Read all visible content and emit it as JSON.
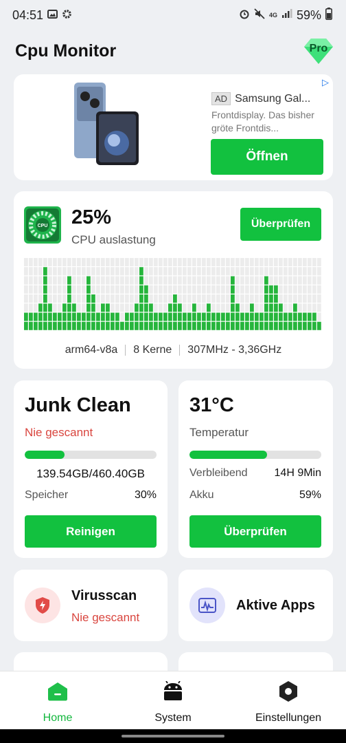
{
  "status_bar": {
    "time": "04:51",
    "left_icons": [
      "image-icon",
      "gear-icon"
    ],
    "right_icons": [
      "alarm-icon",
      "mute-icon",
      "4g-icon",
      "signal-icon"
    ],
    "battery": "59%"
  },
  "app": {
    "title": "Cpu Monitor",
    "pro_badge": "Pro"
  },
  "ad": {
    "tag": "AD",
    "title": "Samsung Gal...",
    "description": "Frontdisplay. Das bisher gröte Frontdis...",
    "button": "Öffnen"
  },
  "cpu": {
    "percent": "25%",
    "label": "CPU auslastung",
    "button": "Überprüfen",
    "arch": "arm64-v8a",
    "cores": "8 Kerne",
    "freq": "307MHz - 3,36GHz",
    "usage_history": [
      2,
      2,
      2,
      3,
      7,
      3,
      2,
      2,
      3,
      6,
      3,
      2,
      2,
      6,
      4,
      2,
      3,
      3,
      2,
      2,
      1,
      2,
      2,
      3,
      7,
      5,
      3,
      2,
      2,
      2,
      3,
      4,
      3,
      2,
      2,
      3,
      2,
      2,
      3,
      2,
      2,
      2,
      2,
      6,
      3,
      2,
      2,
      3,
      2,
      2,
      6,
      5,
      5,
      3,
      2,
      2,
      3,
      2,
      2,
      2,
      2,
      1
    ],
    "grid_rows": 8,
    "grid_accent": "#26b53c",
    "grid_empty": "#ececec"
  },
  "junk": {
    "title": "Junk Clean",
    "status": "Nie gescannt",
    "progress": 0.3,
    "storage_value": "139.54GB/460.40GB",
    "storage_label": "Speicher",
    "storage_percent": "30%",
    "button": "Reinigen"
  },
  "battery": {
    "temperature": "31°C",
    "temperature_label": "Temperatur",
    "progress": 0.59,
    "remaining_label": "Verbleibend",
    "remaining_value": "14H 9Min",
    "battery_label": "Akku",
    "battery_value": "59%",
    "button": "Überprüfen"
  },
  "virus": {
    "title": "Virusscan",
    "status": "Nie gescannt",
    "icon": "shield-bolt-icon"
  },
  "apps": {
    "title": "Aktive Apps",
    "icon": "pulse-chart-icon"
  },
  "nav": [
    {
      "label": "Home",
      "icon": "home-icon",
      "active": true
    },
    {
      "label": "System",
      "icon": "android-icon",
      "active": false
    },
    {
      "label": "Einstellungen",
      "icon": "hexagon-settings-icon",
      "active": false
    }
  ],
  "colors": {
    "accent": "#12c13f",
    "danger": "#d9453e"
  }
}
